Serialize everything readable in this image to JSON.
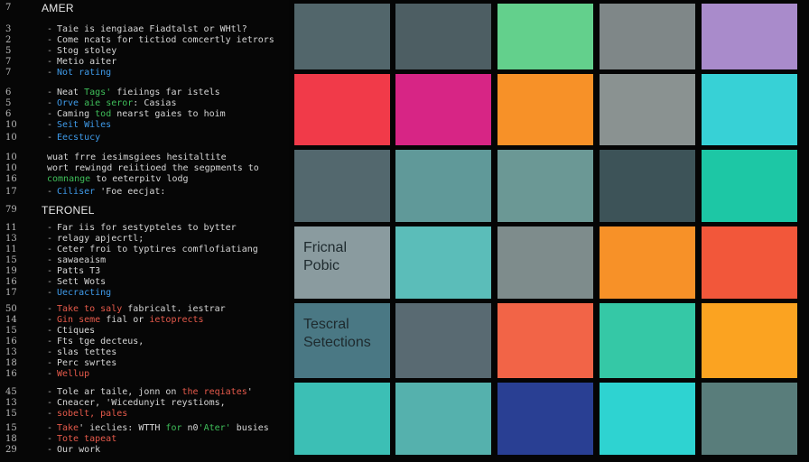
{
  "code_panel": {
    "lines": [
      {
        "num": "7",
        "kind": "heading",
        "text": "AMER"
      },
      {
        "num": "3",
        "kind": "item",
        "color": "white",
        "text": "Taie is iengiaae Fiadtalst or WHtl?"
      },
      {
        "num": "2",
        "kind": "item",
        "color": "white",
        "text": "Come ncats for tictiod comcertly ietrors"
      },
      {
        "num": "5",
        "kind": "item",
        "color": "white",
        "text": "Stog stoley"
      },
      {
        "num": "7",
        "kind": "item",
        "color": "white",
        "text": "Metio aiter"
      },
      {
        "num": "7",
        "kind": "item",
        "color": "blue",
        "text": "Not rating"
      },
      {
        "num": "6",
        "kind": "item",
        "color": "white",
        "segments": [
          {
            "text": "Neat ",
            "color": "white"
          },
          {
            "text": "Tags'",
            "color": "green"
          },
          {
            "text": " fieiings far istels",
            "color": "white"
          }
        ]
      },
      {
        "num": "5",
        "kind": "item",
        "color": "white",
        "segments": [
          {
            "text": "Orve ",
            "color": "blue"
          },
          {
            "text": "aie seror",
            "color": "green"
          },
          {
            "text": ": Casias",
            "color": "white"
          }
        ]
      },
      {
        "num": "6",
        "kind": "item",
        "color": "white",
        "segments": [
          {
            "text": "Caming ",
            "color": "white"
          },
          {
            "text": "tod",
            "color": "green"
          },
          {
            "text": " nearst ",
            "color": "white"
          },
          {
            "text": "gaies to hoim",
            "color": "white"
          }
        ]
      },
      {
        "num": "10",
        "kind": "item",
        "color": "blue",
        "text": "Seit Wiles"
      },
      {
        "num": "10",
        "kind": "item",
        "color": "blue",
        "text": "Eecstucy"
      },
      {
        "num": "10",
        "kind": "plain",
        "color": "white",
        "text": "wuat frre iesimsgiees hesitaltite"
      },
      {
        "num": "10",
        "kind": "plain",
        "color": "white",
        "text": "wort rewingd reiitioed the segpments to"
      },
      {
        "num": "16",
        "kind": "plain",
        "color": "white",
        "segments": [
          {
            "text": "comnange",
            "color": "green"
          },
          {
            "text": " to eeterpitv lodg",
            "color": "white"
          }
        ]
      },
      {
        "num": "17",
        "kind": "item",
        "color": "white",
        "segments": [
          {
            "text": "Ciliser ",
            "color": "blue"
          },
          {
            "text": "'Foe eecjat:",
            "color": "white"
          }
        ]
      },
      {
        "num": "79",
        "kind": "heading",
        "text": "TERONEL"
      },
      {
        "num": "11",
        "kind": "item",
        "color": "white",
        "text": "Far iis for sestypteles to bytter"
      },
      {
        "num": "13",
        "kind": "item",
        "color": "white",
        "text": "relagy apjecrtl;"
      },
      {
        "num": "11",
        "kind": "item",
        "color": "white",
        "text": "Ceter froi to typtires comflofiatiang"
      },
      {
        "num": "15",
        "kind": "item",
        "color": "white",
        "text": "sawaeaism"
      },
      {
        "num": "19",
        "kind": "item",
        "color": "white",
        "text": "Patts T3"
      },
      {
        "num": "16",
        "kind": "item",
        "color": "white",
        "text": "Sett Wots"
      },
      {
        "num": "17",
        "kind": "item",
        "color": "blue",
        "text": "Uecracting"
      },
      {
        "num": "50",
        "kind": "item",
        "color": "white",
        "segments": [
          {
            "text": "Take to saly ",
            "color": "red"
          },
          {
            "text": "fabricalt. ",
            "color": "white"
          },
          {
            "text": "iestrar",
            "color": "white"
          }
        ]
      },
      {
        "num": "14",
        "kind": "item",
        "color": "white",
        "segments": [
          {
            "text": "Gin seme ",
            "color": "red"
          },
          {
            "text": "fial or ",
            "color": "white"
          },
          {
            "text": "ietoprects",
            "color": "red"
          }
        ]
      },
      {
        "num": "15",
        "kind": "item",
        "color": "white",
        "text": "Ctiques"
      },
      {
        "num": "16",
        "kind": "item",
        "color": "white",
        "text": "Fts tge decteus,"
      },
      {
        "num": "13",
        "kind": "item",
        "color": "white",
        "text": "slas tettes"
      },
      {
        "num": "18",
        "kind": "item",
        "color": "white",
        "text": "Perc swrtes"
      },
      {
        "num": "16",
        "kind": "item",
        "color": "red",
        "text": "Wellup"
      },
      {
        "num": "45",
        "kind": "item",
        "color": "white",
        "segments": [
          {
            "text": "Tole ar taile, jonn on ",
            "color": "white"
          },
          {
            "text": "the reqiates",
            "color": "red"
          },
          {
            "text": "'",
            "color": "white"
          }
        ]
      },
      {
        "num": "13",
        "kind": "item",
        "color": "white",
        "text": "Cneacer, 'Wicedunyit reystioms,"
      },
      {
        "num": "15",
        "kind": "item",
        "color": "red",
        "text": "sobelt, pales"
      },
      {
        "num": "15",
        "kind": "item",
        "color": "white",
        "segments": [
          {
            "text": "Take",
            "color": "red"
          },
          {
            "text": "'  ieclies: WTTH ",
            "color": "white"
          },
          {
            "text": "for",
            "color": "green"
          },
          {
            "text": " n0",
            "color": "white"
          },
          {
            "text": "'Ater'",
            "color": "green"
          },
          {
            "text": " busies",
            "color": "white"
          }
        ]
      },
      {
        "num": "18",
        "kind": "item",
        "color": "red",
        "text": "Tote tapeat"
      },
      {
        "num": "29",
        "kind": "item",
        "color": "white",
        "text": "Our work"
      }
    ]
  },
  "swatches": {
    "rows": [
      [
        "#52666b",
        "#4d5e63",
        "#63d08c",
        "#7f8788",
        "#a98bcb"
      ],
      [
        "#f13a49",
        "#d72585",
        "#f79128",
        "#8a9291",
        "#37d1d6"
      ],
      [
        "#53686e",
        "#609999",
        "#6b9895",
        "#3d5358",
        "#1dc7a5"
      ],
      [
        "#8a9b9f",
        "#5bbdb9",
        "#7e8c8c",
        "#f79128",
        "#f2573a"
      ],
      [
        "#4a7884",
        "#596a72",
        "#f26447",
        "#35c8a6",
        "#fba321"
      ],
      [
        "#3cbfb5",
        "#55b1ad",
        "#293f93",
        "#2ed3d1",
        "#597d7b"
      ]
    ],
    "labels": {
      "row4_col1": {
        "line1": "Fricnal",
        "line2": "Pobic"
      },
      "row5_col1": {
        "line1": "Tescral",
        "line2": "Setections"
      }
    }
  }
}
